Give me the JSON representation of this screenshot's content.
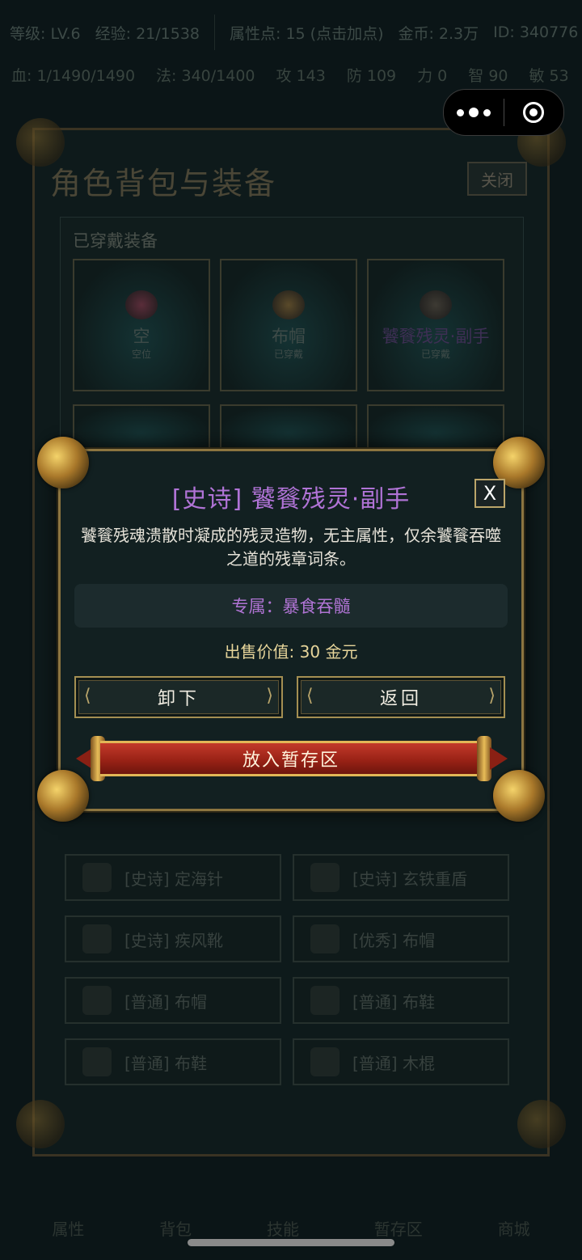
{
  "status_bar": {
    "row1": [
      "等级: LV.6",
      "经验: 21/1538",
      "属性点: 15 (点击加点)",
      "金币: 2.3万",
      "ID: 340776"
    ],
    "row2": [
      "血: 1/1490/1490",
      "法: 340/1400",
      "攻 143",
      "防 109",
      "力 0",
      "智 90",
      "敏 53"
    ]
  },
  "background": {
    "tabs": "角色背包与装备",
    "title": "角色背包与装备",
    "close_label": "关闭",
    "equipped_heading": "已穿戴装备",
    "slots": [
      {
        "name": "空",
        "state": "空位"
      },
      {
        "name": "布帽",
        "state": "已穿戴"
      },
      {
        "name": "饕餮残灵·副手",
        "state": "已穿戴"
      }
    ],
    "inventory": [
      "[史诗] 定海针",
      "[史诗] 玄铁重盾",
      "[史诗] 疾风靴",
      "[优秀] 布帽",
      "[普通] 布帽",
      "[普通] 布鞋",
      "[普通] 布鞋",
      "[普通] 木棍"
    ],
    "bottom_nav": [
      "属性",
      "背包",
      "技能",
      "暂存区",
      "商城"
    ]
  },
  "modal": {
    "title": "[史诗] 饕餮残灵·副手",
    "close_label": "X",
    "description": "饕餮残魂溃散时凝成的残灵造物，无主属性，仅余饕餮吞噬之道的残章词条。",
    "exclusive": "专属：暴食吞髓",
    "price": "出售价值: 30 金元",
    "unequip_label": "卸下",
    "back_label": "返回",
    "stash_label": "放入暂存区"
  },
  "colors": {
    "epic_purple": "#b073d6",
    "gold_frame": "#8c7540",
    "price_gold": "#e7d59a",
    "scroll_red": "#9a2216"
  }
}
